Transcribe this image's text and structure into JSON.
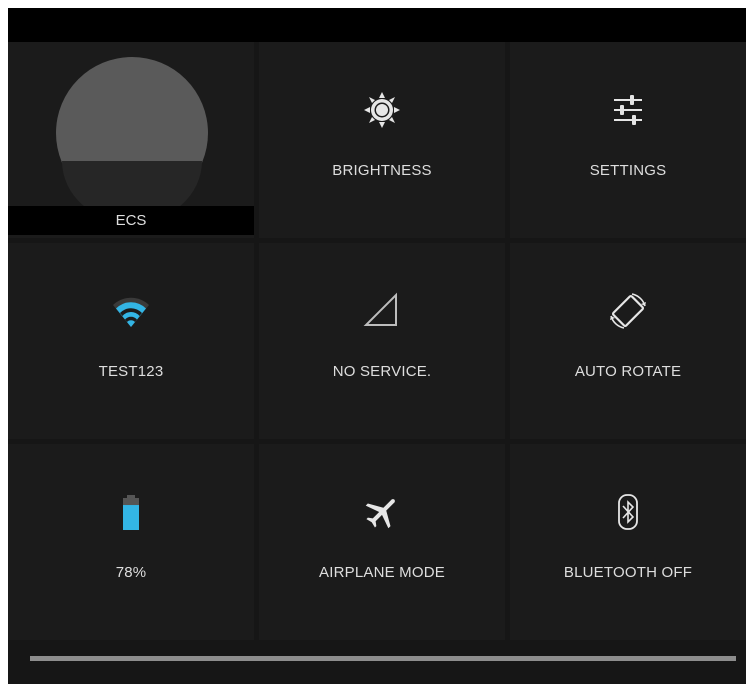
{
  "user": {
    "name": "ECS"
  },
  "tiles": {
    "brightness": {
      "label": "BRIGHTNESS",
      "icon": "brightness-icon"
    },
    "settings": {
      "label": "SETTINGS",
      "icon": "settings-sliders-icon"
    },
    "wifi": {
      "label": "TEST123",
      "icon": "wifi-icon"
    },
    "signal": {
      "label": "NO SERVICE.",
      "icon": "signal-icon"
    },
    "rotate": {
      "label": "AUTO ROTATE",
      "icon": "auto-rotate-icon"
    },
    "battery": {
      "label": "78%",
      "icon": "battery-icon",
      "level": 0.78
    },
    "airplane": {
      "label": "AIRPLANE MODE",
      "icon": "airplane-icon"
    },
    "bluetooth": {
      "label": "BLUETOOTH OFF",
      "icon": "bluetooth-icon"
    }
  },
  "colors": {
    "accent": "#33b5e5",
    "tile_bg": "#1b1b1b",
    "panel_bg": "#161616",
    "text": "#dedede"
  }
}
